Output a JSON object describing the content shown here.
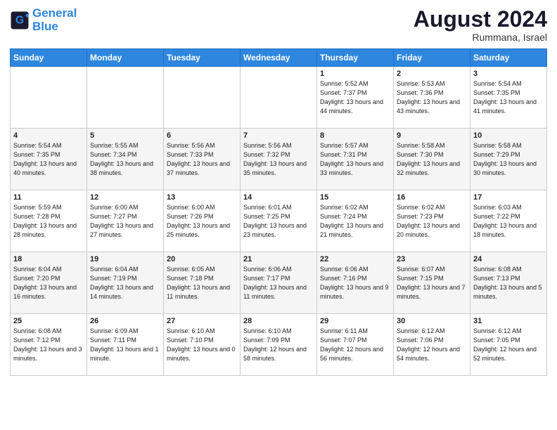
{
  "header": {
    "logo_line1": "General",
    "logo_line2": "Blue",
    "month_year": "August 2024",
    "location": "Rummana, Israel"
  },
  "weekdays": [
    "Sunday",
    "Monday",
    "Tuesday",
    "Wednesday",
    "Thursday",
    "Friday",
    "Saturday"
  ],
  "weeks": [
    [
      {
        "day": "",
        "sunrise": "",
        "sunset": "",
        "daylight": ""
      },
      {
        "day": "",
        "sunrise": "",
        "sunset": "",
        "daylight": ""
      },
      {
        "day": "",
        "sunrise": "",
        "sunset": "",
        "daylight": ""
      },
      {
        "day": "",
        "sunrise": "",
        "sunset": "",
        "daylight": ""
      },
      {
        "day": "1",
        "sunrise": "Sunrise: 5:52 AM",
        "sunset": "Sunset: 7:37 PM",
        "daylight": "Daylight: 13 hours and 44 minutes."
      },
      {
        "day": "2",
        "sunrise": "Sunrise: 5:53 AM",
        "sunset": "Sunset: 7:36 PM",
        "daylight": "Daylight: 13 hours and 43 minutes."
      },
      {
        "day": "3",
        "sunrise": "Sunrise: 5:54 AM",
        "sunset": "Sunset: 7:35 PM",
        "daylight": "Daylight: 13 hours and 41 minutes."
      }
    ],
    [
      {
        "day": "4",
        "sunrise": "Sunrise: 5:54 AM",
        "sunset": "Sunset: 7:35 PM",
        "daylight": "Daylight: 13 hours and 40 minutes."
      },
      {
        "day": "5",
        "sunrise": "Sunrise: 5:55 AM",
        "sunset": "Sunset: 7:34 PM",
        "daylight": "Daylight: 13 hours and 38 minutes."
      },
      {
        "day": "6",
        "sunrise": "Sunrise: 5:56 AM",
        "sunset": "Sunset: 7:33 PM",
        "daylight": "Daylight: 13 hours and 37 minutes."
      },
      {
        "day": "7",
        "sunrise": "Sunrise: 5:56 AM",
        "sunset": "Sunset: 7:32 PM",
        "daylight": "Daylight: 13 hours and 35 minutes."
      },
      {
        "day": "8",
        "sunrise": "Sunrise: 5:57 AM",
        "sunset": "Sunset: 7:31 PM",
        "daylight": "Daylight: 13 hours and 33 minutes."
      },
      {
        "day": "9",
        "sunrise": "Sunrise: 5:58 AM",
        "sunset": "Sunset: 7:30 PM",
        "daylight": "Daylight: 13 hours and 32 minutes."
      },
      {
        "day": "10",
        "sunrise": "Sunrise: 5:58 AM",
        "sunset": "Sunset: 7:29 PM",
        "daylight": "Daylight: 13 hours and 30 minutes."
      }
    ],
    [
      {
        "day": "11",
        "sunrise": "Sunrise: 5:59 AM",
        "sunset": "Sunset: 7:28 PM",
        "daylight": "Daylight: 13 hours and 28 minutes."
      },
      {
        "day": "12",
        "sunrise": "Sunrise: 6:00 AM",
        "sunset": "Sunset: 7:27 PM",
        "daylight": "Daylight: 13 hours and 27 minutes."
      },
      {
        "day": "13",
        "sunrise": "Sunrise: 6:00 AM",
        "sunset": "Sunset: 7:26 PM",
        "daylight": "Daylight: 13 hours and 25 minutes."
      },
      {
        "day": "14",
        "sunrise": "Sunrise: 6:01 AM",
        "sunset": "Sunset: 7:25 PM",
        "daylight": "Daylight: 13 hours and 23 minutes."
      },
      {
        "day": "15",
        "sunrise": "Sunrise: 6:02 AM",
        "sunset": "Sunset: 7:24 PM",
        "daylight": "Daylight: 13 hours and 21 minutes."
      },
      {
        "day": "16",
        "sunrise": "Sunrise: 6:02 AM",
        "sunset": "Sunset: 7:23 PM",
        "daylight": "Daylight: 13 hours and 20 minutes."
      },
      {
        "day": "17",
        "sunrise": "Sunrise: 6:03 AM",
        "sunset": "Sunset: 7:22 PM",
        "daylight": "Daylight: 13 hours and 18 minutes."
      }
    ],
    [
      {
        "day": "18",
        "sunrise": "Sunrise: 6:04 AM",
        "sunset": "Sunset: 7:20 PM",
        "daylight": "Daylight: 13 hours and 16 minutes."
      },
      {
        "day": "19",
        "sunrise": "Sunrise: 6:04 AM",
        "sunset": "Sunset: 7:19 PM",
        "daylight": "Daylight: 13 hours and 14 minutes."
      },
      {
        "day": "20",
        "sunrise": "Sunrise: 6:05 AM",
        "sunset": "Sunset: 7:18 PM",
        "daylight": "Daylight: 13 hours and 11 minutes."
      },
      {
        "day": "21",
        "sunrise": "Sunrise: 6:06 AM",
        "sunset": "Sunset: 7:17 PM",
        "daylight": "Daylight: 13 hours and 11 minutes."
      },
      {
        "day": "22",
        "sunrise": "Sunrise: 6:06 AM",
        "sunset": "Sunset: 7:16 PM",
        "daylight": "Daylight: 13 hours and 9 minutes."
      },
      {
        "day": "23",
        "sunrise": "Sunrise: 6:07 AM",
        "sunset": "Sunset: 7:15 PM",
        "daylight": "Daylight: 13 hours and 7 minutes."
      },
      {
        "day": "24",
        "sunrise": "Sunrise: 6:08 AM",
        "sunset": "Sunset: 7:13 PM",
        "daylight": "Daylight: 13 hours and 5 minutes."
      }
    ],
    [
      {
        "day": "25",
        "sunrise": "Sunrise: 6:08 AM",
        "sunset": "Sunset: 7:12 PM",
        "daylight": "Daylight: 13 hours and 3 minutes."
      },
      {
        "day": "26",
        "sunrise": "Sunrise: 6:09 AM",
        "sunset": "Sunset: 7:11 PM",
        "daylight": "Daylight: 13 hours and 1 minute."
      },
      {
        "day": "27",
        "sunrise": "Sunrise: 6:10 AM",
        "sunset": "Sunset: 7:10 PM",
        "daylight": "Daylight: 13 hours and 0 minutes."
      },
      {
        "day": "28",
        "sunrise": "Sunrise: 6:10 AM",
        "sunset": "Sunset: 7:09 PM",
        "daylight": "Daylight: 12 hours and 58 minutes."
      },
      {
        "day": "29",
        "sunrise": "Sunrise: 6:11 AM",
        "sunset": "Sunset: 7:07 PM",
        "daylight": "Daylight: 12 hours and 56 minutes."
      },
      {
        "day": "30",
        "sunrise": "Sunrise: 6:12 AM",
        "sunset": "Sunset: 7:06 PM",
        "daylight": "Daylight: 12 hours and 54 minutes."
      },
      {
        "day": "31",
        "sunrise": "Sunrise: 6:12 AM",
        "sunset": "Sunset: 7:05 PM",
        "daylight": "Daylight: 12 hours and 52 minutes."
      }
    ]
  ]
}
